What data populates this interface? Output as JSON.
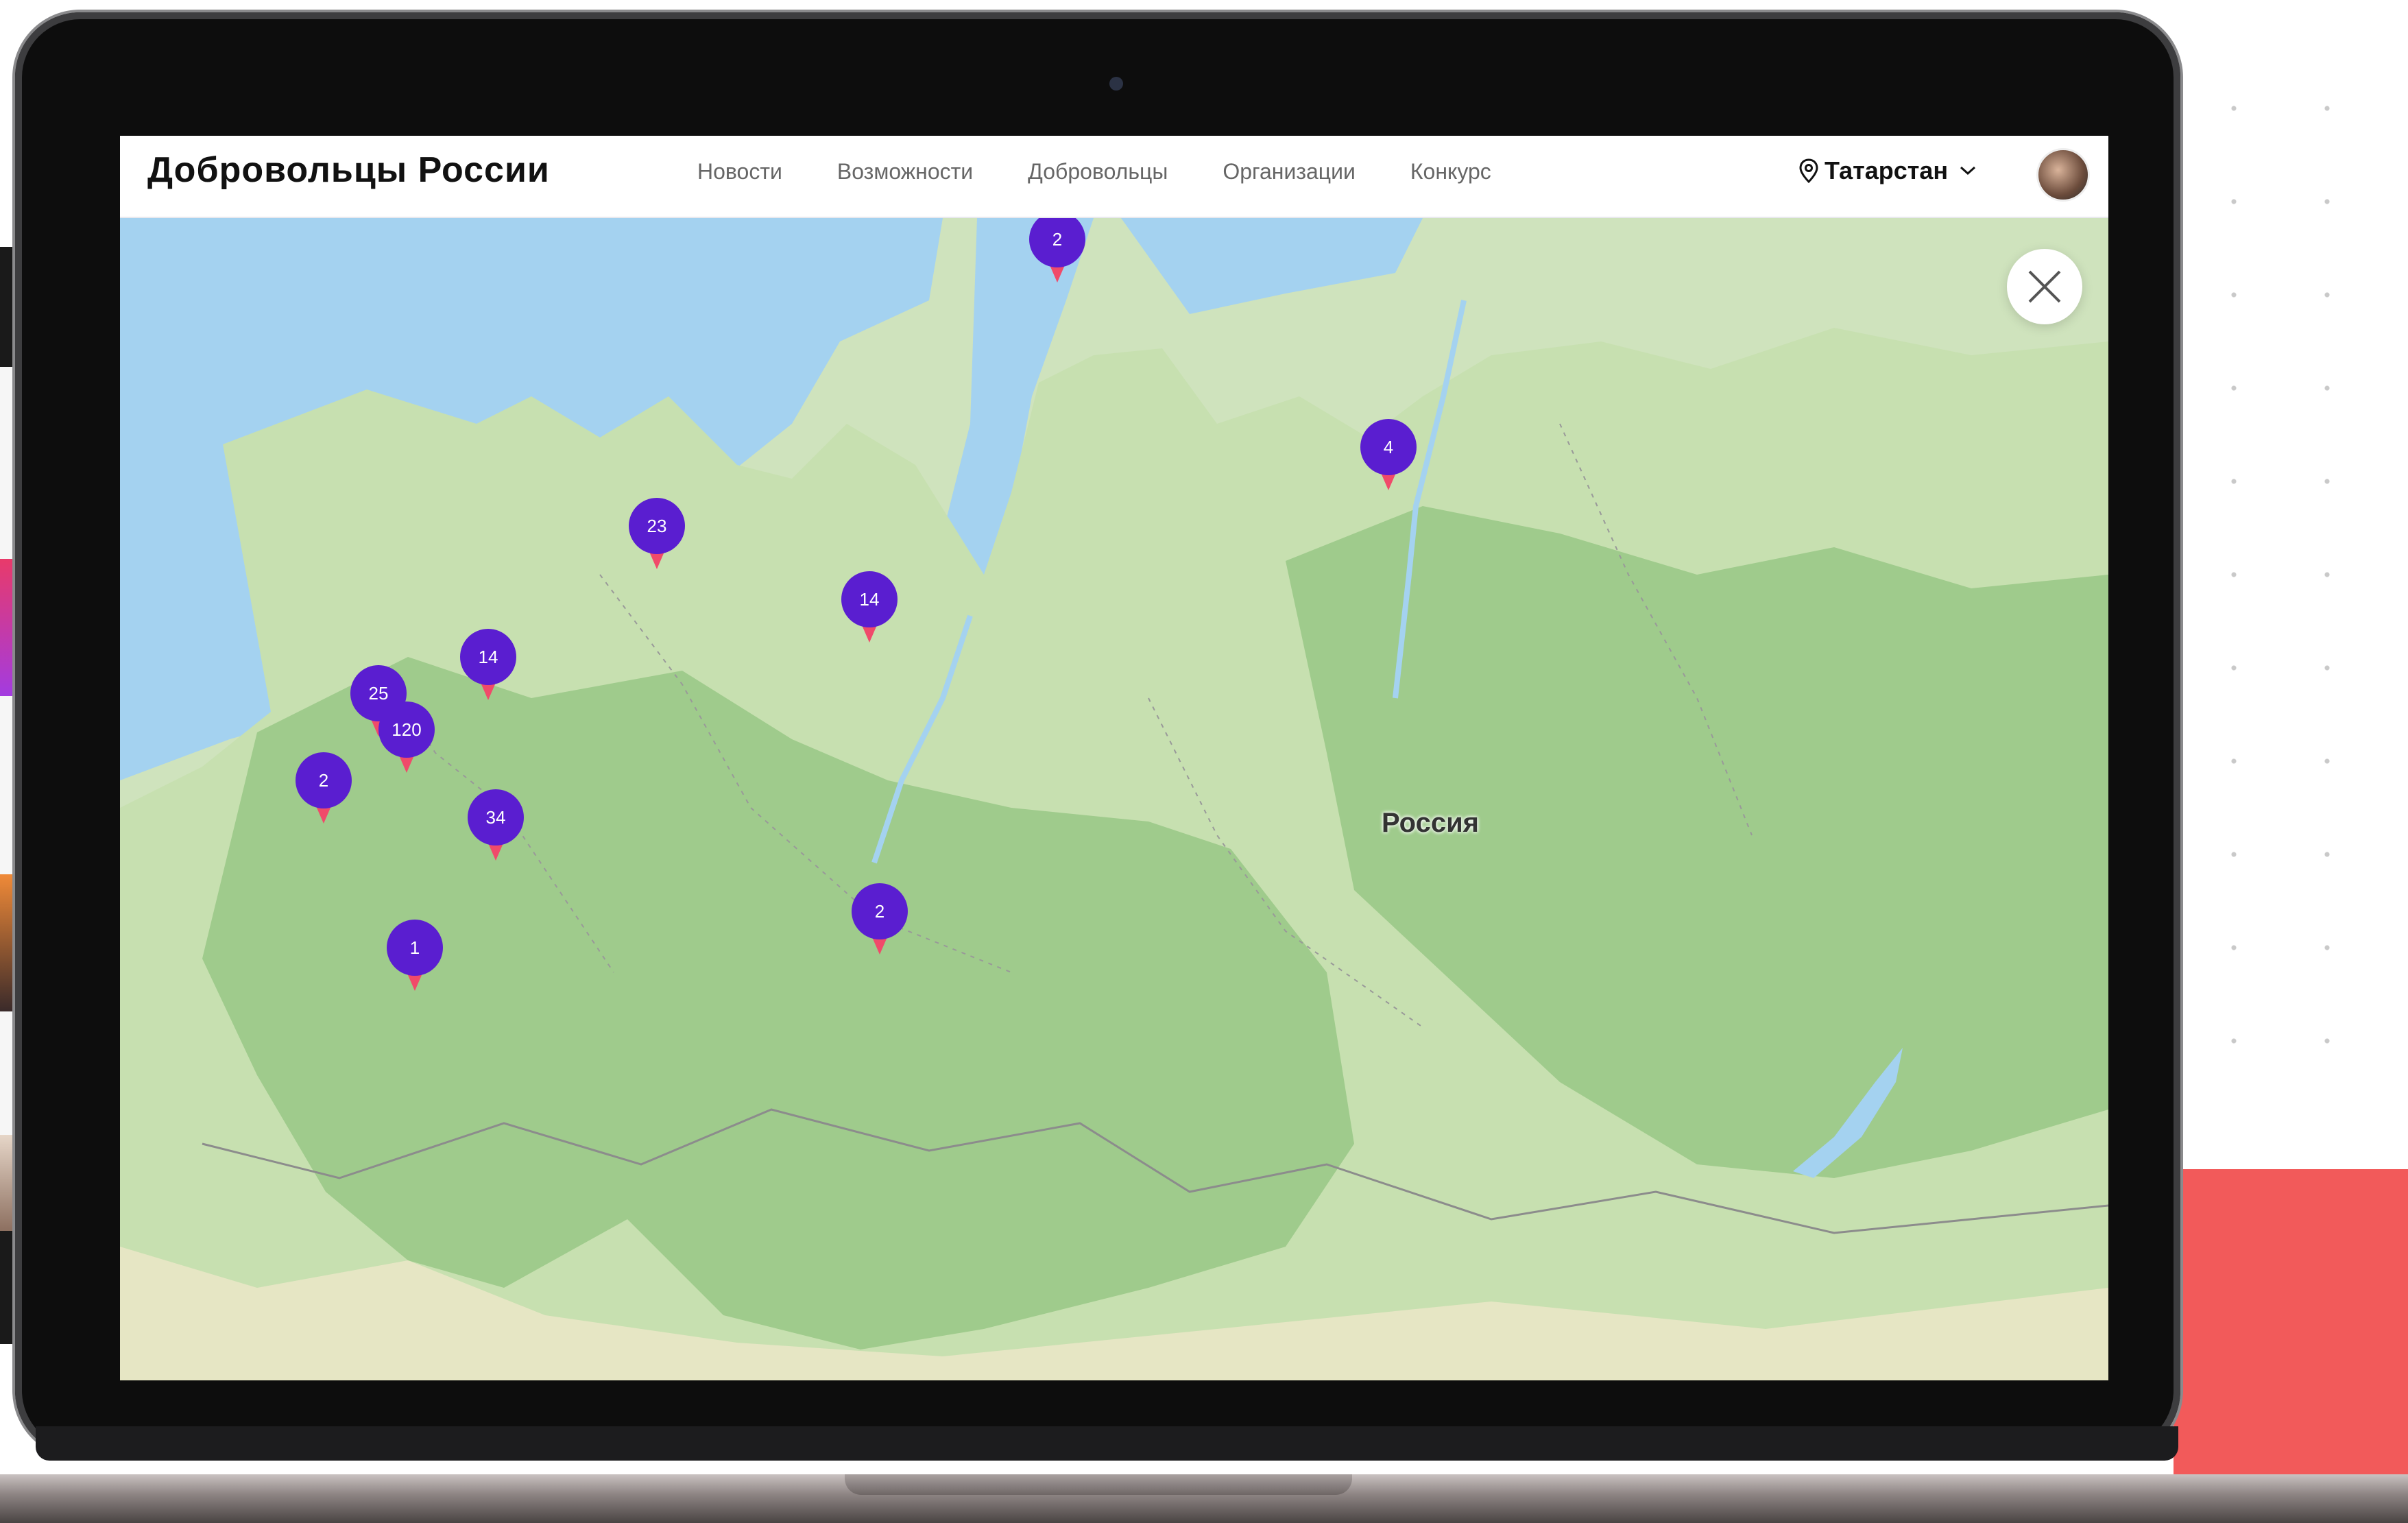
{
  "header": {
    "logo": "Добровольцы России",
    "nav": [
      "Новости",
      "Возможности",
      "Добровольцы",
      "Организации",
      "Конкурс"
    ],
    "region": "Татарстан"
  },
  "map": {
    "country_label": "Россия",
    "markers": [
      {
        "count": "2"
      },
      {
        "count": "4"
      },
      {
        "count": "23"
      },
      {
        "count": "14"
      },
      {
        "count": "14"
      },
      {
        "count": "25"
      },
      {
        "count": "120"
      },
      {
        "count": "2"
      },
      {
        "count": "34"
      },
      {
        "count": "2"
      },
      {
        "count": "1"
      }
    ]
  },
  "colors": {
    "marker": "#5a1ed0",
    "marker_tip": "#f04a6a",
    "accent_block": "#f25a5a"
  }
}
